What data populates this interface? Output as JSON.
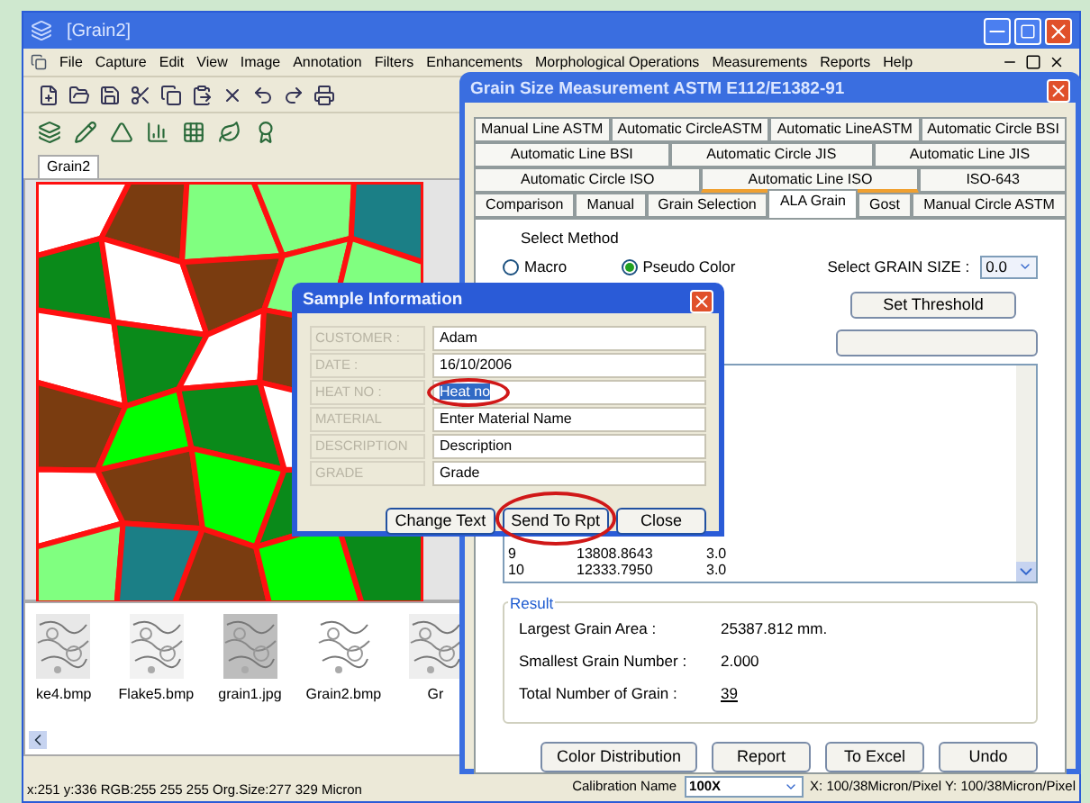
{
  "main_window": {
    "title": "[Grain2]",
    "menu": [
      "File",
      "Capture",
      "Edit",
      "View",
      "Image",
      "Annotation",
      "Filters",
      "Enhancements",
      "Morphological Operations",
      "Measurements",
      "Reports",
      "Help"
    ],
    "document_tab": "Grain2",
    "thumbnails": [
      {
        "label": "ke4.bmp"
      },
      {
        "label": "Flake5.bmp"
      },
      {
        "label": "grain1.jpg"
      },
      {
        "label": "Grain2.bmp"
      },
      {
        "label": "Gr"
      }
    ],
    "status_bar": "x:251 y:336 RGB:255 255 255 Org.Size:277 329 Micron",
    "calibration": {
      "label": "Calibration Name",
      "value": "100X",
      "scale": "X: 100/38Micron/Pixel Y: 100/38Micron/Pixel"
    }
  },
  "grain_dialog": {
    "title": "Grain Size Measurement ASTM E112/E1382-91",
    "tab_rows": [
      [
        {
          "label": "Manual Line ASTM",
          "selected": false,
          "underlined": false
        },
        {
          "label": "Automatic CircleASTM",
          "selected": false,
          "underlined": false
        },
        {
          "label": "Automatic LineASTM",
          "selected": false,
          "underlined": false
        },
        {
          "label": "Automatic Circle BSI",
          "selected": false,
          "underlined": false
        }
      ],
      [
        {
          "label": "Automatic Line BSI",
          "selected": false,
          "underlined": false
        },
        {
          "label": "Automatic Circle JIS",
          "selected": false,
          "underlined": false
        },
        {
          "label": "Automatic Line JIS",
          "selected": false,
          "underlined": false
        }
      ],
      [
        {
          "label": "Automatic Circle ISO",
          "selected": false,
          "underlined": false
        },
        {
          "label": "Automatic Line ISO",
          "selected": false,
          "underlined": true
        },
        {
          "label": "ISO-643",
          "selected": false,
          "underlined": false
        }
      ],
      [
        {
          "label": "Comparison",
          "selected": false,
          "underlined": false
        },
        {
          "label": "Manual",
          "selected": false,
          "underlined": false
        },
        {
          "label": "Grain Selection",
          "selected": false,
          "underlined": false
        },
        {
          "label": "ALA Grain",
          "selected": true,
          "underlined": false
        },
        {
          "label": "Gost",
          "selected": false,
          "underlined": false
        },
        {
          "label": "Manual Circle ASTM",
          "selected": false,
          "underlined": false
        }
      ]
    ],
    "method": {
      "label": "Select Method",
      "options": [
        {
          "label": "Macro",
          "selected": false
        },
        {
          "label": "Pseudo Color",
          "selected": true
        }
      ]
    },
    "grain_size": {
      "label": "Select GRAIN SIZE :",
      "value": "0.0"
    },
    "threshold_button": "Set Threshold",
    "table_rows": [
      [
        "9",
        "13808.8643",
        "3.0"
      ],
      [
        "10",
        "12333.7950",
        "3.0"
      ]
    ],
    "result": {
      "title": "Result",
      "items": [
        {
          "label": "Largest Grain Area :",
          "value": "25387.812 mm."
        },
        {
          "label": "Smallest Grain Number :",
          "value": "2.000"
        },
        {
          "label": "Total Number of Grain :",
          "value": "39"
        }
      ]
    },
    "buttons": [
      "Color Distribution",
      "Report",
      "To Excel",
      "Undo"
    ]
  },
  "sample_dialog": {
    "title": "Sample Information",
    "fields": [
      {
        "label": "CUSTOMER :",
        "value": "Adam",
        "selected": false,
        "circled": false
      },
      {
        "label": "DATE :",
        "value": "16/10/2006",
        "selected": false,
        "circled": false
      },
      {
        "label": "HEAT NO :",
        "value": "Heat no",
        "selected": true,
        "circled": true
      },
      {
        "label": "MATERIAL",
        "value": "Enter Material Name",
        "selected": false,
        "circled": false
      },
      {
        "label": "DESCRIPTION",
        "value": "Description",
        "selected": false,
        "circled": false
      },
      {
        "label": "GRADE",
        "value": "Grade",
        "selected": false,
        "circled": false
      }
    ],
    "buttons": [
      {
        "label": "Change Text",
        "circled": false
      },
      {
        "label": "Send To Rpt",
        "circled": true
      },
      {
        "label": "Close",
        "circled": false
      }
    ]
  }
}
